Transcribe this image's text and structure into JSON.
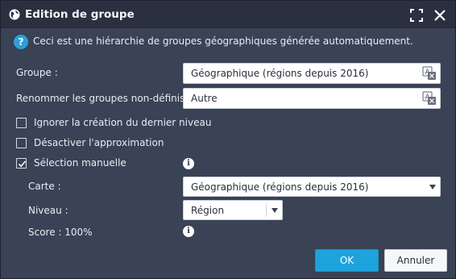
{
  "dialog": {
    "title": "Edition de groupe",
    "info_text": "Ceci est une hiérarchie de groupes géographiques générée automatiquement.",
    "accent_color": "#1ea3dd"
  },
  "form": {
    "groupe_label": "Groupe :",
    "groupe_value": "Géographique (régions depuis 2016)",
    "rename_label": "Renommer les groupes non-définis",
    "rename_value": "Autre",
    "ignore_last_level_label": "Ignorer la création du dernier niveau",
    "ignore_last_level_checked": false,
    "disable_approx_label": "Désactiver l'approximation",
    "disable_approx_checked": false,
    "manual_selection_label": "Sélection manuelle",
    "manual_selection_checked": true,
    "carte_label": "Carte :",
    "carte_value": "Géographique (régions depuis 2016)",
    "niveau_label": "Niveau :",
    "niveau_value": "Région",
    "score_label": "Score : 100%"
  },
  "buttons": {
    "ok_label": "OK",
    "cancel_label": "Annuler"
  },
  "icons": {
    "app": "globe-icon",
    "maximize": "maximize-icon",
    "close": "close-icon",
    "info": "question-icon",
    "translate": "translate-icon",
    "details": "info-icon"
  }
}
